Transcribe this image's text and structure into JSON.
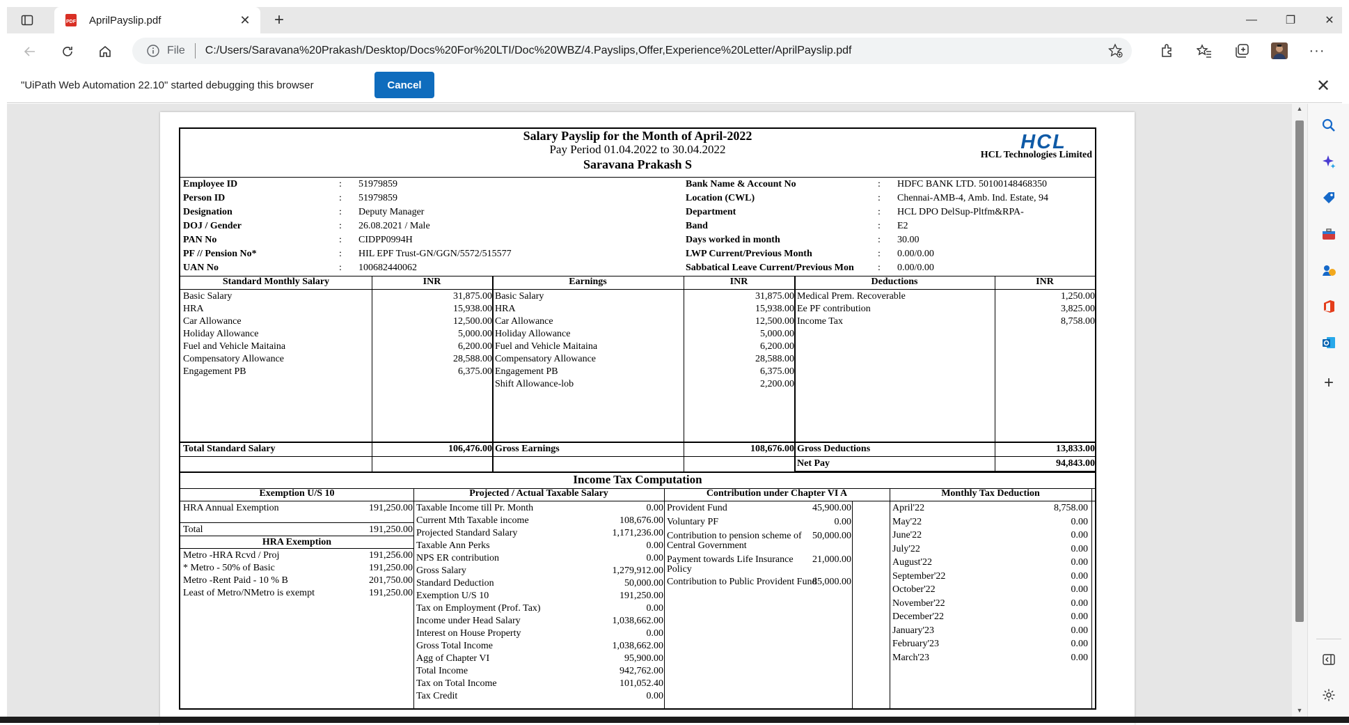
{
  "browser": {
    "tab_title": "AprilPayslip.pdf",
    "url_scheme_label": "File",
    "url": "C:/Users/Saravana%20Prakash/Desktop/Docs%20For%20LTI/Doc%20WBZ/4.Payslips,Offer,Experience%20Letter/AprilPayslip.pdf",
    "infobar_message": "\"UiPath Web Automation 22.10\" started debugging this browser",
    "infobar_button": "Cancel"
  },
  "payslip": {
    "title": "Salary Payslip for the Month of April-2022",
    "period": "Pay Period 01.04.2022 to 30.04.2022",
    "employee_name": "Saravana Prakash  S",
    "logo_text": "HCL",
    "company": "HCL Technologies Limited",
    "colon": ":",
    "left_fields": [
      {
        "k": "Employee ID",
        "v": "51979859"
      },
      {
        "k": "Person ID",
        "v": "51979859"
      },
      {
        "k": "Designation",
        "v": "Deputy Manager"
      },
      {
        "k": "DOJ / Gender",
        "v": "26.08.2021 / Male"
      },
      {
        "k": "PAN No",
        "v": "CIDPP0994H"
      },
      {
        "k": "PF // Pension No*",
        "v": "HIL EPF Trust-GN/GGN/5572/515577"
      },
      {
        "k": "UAN No",
        "v": "100682440062"
      }
    ],
    "right_fields": [
      {
        "k": "Bank Name & Account No",
        "v": "HDFC BANK LTD. 50100148468350"
      },
      {
        "k": "Location (CWL)",
        "v": "Chennai-AMB-4, Amb. Ind. Estate, 94"
      },
      {
        "k": "Department",
        "v": "HCL DPO DelSup-Pltfm&RPA-"
      },
      {
        "k": "Band",
        "v": "E2"
      },
      {
        "k": "Days worked in month",
        "v": "30.00"
      },
      {
        "k": "LWP Current/Previous Month",
        "v": "0.00/0.00"
      },
      {
        "k": "Sabbatical Leave Current/Previous Mon",
        "v": "0.00/0.00"
      }
    ],
    "salary": {
      "headers": {
        "standard": "Standard Monthly Salary",
        "inr": "INR",
        "earnings": "Earnings",
        "deductions": "Deductions"
      },
      "standard": [
        {
          "k": "Basic Salary",
          "v": "31,875.00"
        },
        {
          "k": "HRA",
          "v": "15,938.00"
        },
        {
          "k": "Car Allowance",
          "v": "12,500.00"
        },
        {
          "k": "Holiday Allowance",
          "v": "5,000.00"
        },
        {
          "k": "Fuel and Vehicle Maitaina",
          "v": "6,200.00"
        },
        {
          "k": "Compensatory Allowance",
          "v": "28,588.00"
        },
        {
          "k": "Engagement PB",
          "v": "6,375.00"
        }
      ],
      "earnings": [
        {
          "k": "Basic Salary",
          "v": "31,875.00"
        },
        {
          "k": "HRA",
          "v": "15,938.00"
        },
        {
          "k": "Car Allowance",
          "v": "12,500.00"
        },
        {
          "k": "Holiday Allowance",
          "v": "5,000.00"
        },
        {
          "k": "Fuel and Vehicle Maitaina",
          "v": "6,200.00"
        },
        {
          "k": "Compensatory Allowance",
          "v": "28,588.00"
        },
        {
          "k": "Engagement PB",
          "v": "6,375.00"
        },
        {
          "k": "Shift Allowance-lob",
          "v": "2,200.00"
        }
      ],
      "deductions": [
        {
          "k": "Medical Prem. Recoverable",
          "v": "1,250.00"
        },
        {
          "k": "Ee PF contribution",
          "v": "3,825.00"
        },
        {
          "k": "Income Tax",
          "v": "8,758.00"
        }
      ],
      "totals": {
        "standard_label": "Total Standard Salary",
        "standard_value": "106,476.00",
        "gross_label": "Gross Earnings",
        "gross_value": "108,676.00",
        "ded_label": "Gross Deductions",
        "ded_value": "13,833.00",
        "net_label": "Net Pay",
        "net_value": "94,843.00"
      }
    },
    "tax": {
      "title": "Income Tax Computation",
      "headers": {
        "exemption": "Exemption U/S 10",
        "projected": "Projected / Actual Taxable Salary",
        "chapter": "Contribution under Chapter VI A",
        "monthly": "Monthly Tax Deduction"
      },
      "exemption": [
        {
          "k": "HRA Annual Exemption",
          "v": "191,250.00"
        }
      ],
      "total_label": "Total",
      "total_value": "191,250.00",
      "hra_title": "HRA Exemption",
      "hra": [
        {
          "k": "Metro -HRA Rcvd / Proj",
          "v": "191,256.00"
        },
        {
          "k": "* Metro - 50% of Basic",
          "v": "191,250.00"
        },
        {
          "k": "Metro -Rent Paid - 10 % B",
          "v": "201,750.00"
        },
        {
          "k": "Least of Metro/NMetro is exempt",
          "v": "191,250.00"
        }
      ],
      "projected": [
        {
          "k": "Taxable Income till Pr. Month",
          "v": "0.00"
        },
        {
          "k": "Current Mth Taxable income",
          "v": "108,676.00"
        },
        {
          "k": "Projected Standard Salary",
          "v": "1,171,236.00"
        },
        {
          "k": "Taxable Ann Perks",
          "v": "0.00"
        },
        {
          "k": "NPS ER contribution",
          "v": "0.00"
        },
        {
          "k": "Gross Salary",
          "v": "1,279,912.00"
        },
        {
          "k": "Standard Deduction",
          "v": "50,000.00"
        },
        {
          "k": "Exemption U/S 10",
          "v": "191,250.00"
        },
        {
          "k": "Tax on Employment (Prof. Tax)",
          "v": "0.00"
        },
        {
          "k": "Income under Head Salary",
          "v": "1,038,662.00"
        },
        {
          "k": "Interest on House Property",
          "v": "0.00"
        },
        {
          "k": "Gross Total Income",
          "v": "1,038,662.00"
        },
        {
          "k": "Agg of Chapter VI",
          "v": "95,900.00"
        },
        {
          "k": "Total Income",
          "v": "942,762.00"
        },
        {
          "k": "Tax on Total Income",
          "v": "101,052.40"
        },
        {
          "k": "Tax Credit",
          "v": "0.00"
        }
      ],
      "chapter": [
        {
          "k": "Provident Fund",
          "v": "45,900.00"
        },
        {
          "k": "Voluntary PF",
          "v": "0.00"
        },
        {
          "k": "Contribution to pension scheme of",
          "k2": "Central Government",
          "v": "50,000.00"
        },
        {
          "k": "Payment towards Life Insurance",
          "k2": "Policy",
          "v": "21,000.00"
        },
        {
          "k": "Contribution to Public Provident Fund",
          "v": "85,000.00"
        }
      ],
      "monthly": [
        {
          "k": "April'22",
          "v": "8,758.00"
        },
        {
          "k": "May'22",
          "v": "0.00"
        },
        {
          "k": "June'22",
          "v": "0.00"
        },
        {
          "k": "July'22",
          "v": "0.00"
        },
        {
          "k": "August'22",
          "v": "0.00"
        },
        {
          "k": "September'22",
          "v": "0.00"
        },
        {
          "k": "October'22",
          "v": "0.00"
        },
        {
          "k": "November'22",
          "v": "0.00"
        },
        {
          "k": "December'22",
          "v": "0.00"
        },
        {
          "k": "January'23",
          "v": "0.00"
        },
        {
          "k": "February'23",
          "v": "0.00"
        },
        {
          "k": "March'23",
          "v": "0.00"
        }
      ]
    }
  }
}
